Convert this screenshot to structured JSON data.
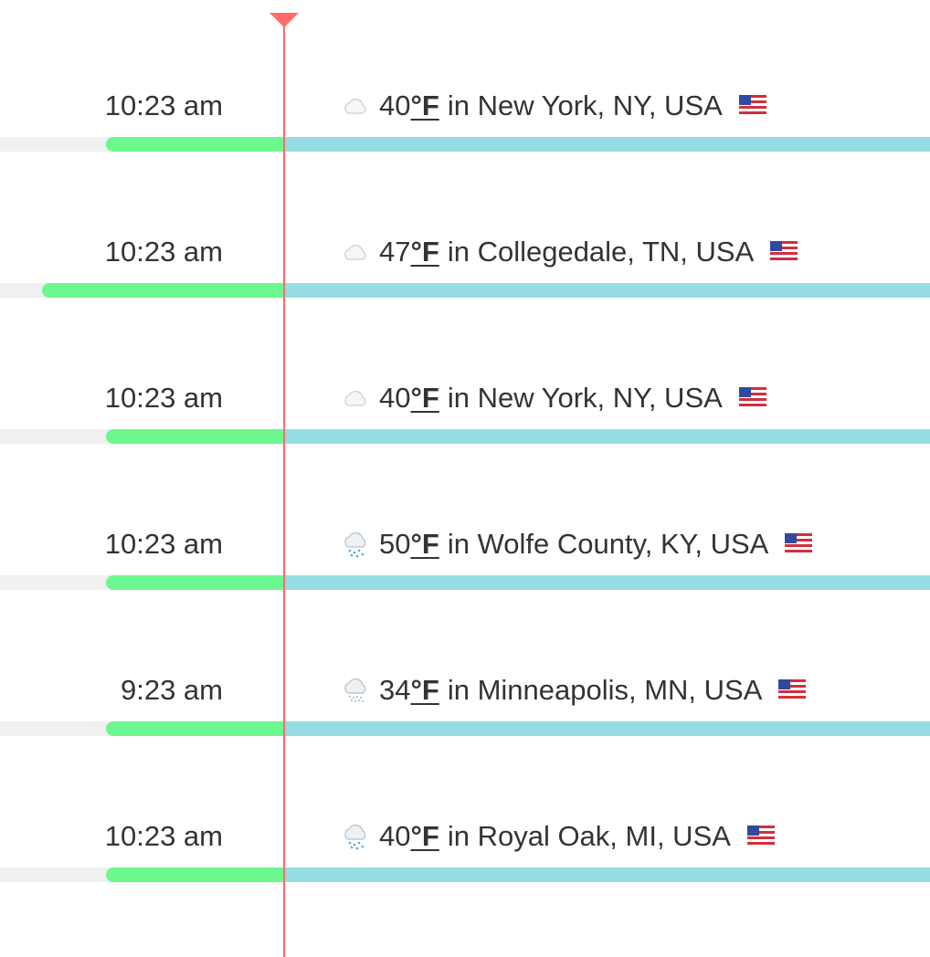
{
  "colors": {
    "now_line": "#ff6b6b",
    "past_bar": "#6cf78f",
    "future_bar": "#98dce3",
    "track": "#f0f0f0",
    "text": "#333333"
  },
  "rows": [
    {
      "time": "10:23 am",
      "icon": "cloud-icon",
      "temp": "40",
      "unit": "°F",
      "location": "in New York, NY, USA",
      "flag": "us-flag-icon"
    },
    {
      "time": "10:23 am",
      "icon": "cloud-icon",
      "temp": "47",
      "unit": "°F",
      "location": "in Collegedale, TN, USA",
      "flag": "us-flag-icon"
    },
    {
      "time": "10:23 am",
      "icon": "cloud-icon",
      "temp": "40",
      "unit": "°F",
      "location": "in New York, NY, USA",
      "flag": "us-flag-icon"
    },
    {
      "time": "10:23 am",
      "icon": "rain-cloud-icon",
      "temp": "50",
      "unit": "°F",
      "location": "in Wolfe County, KY, USA",
      "flag": "us-flag-icon"
    },
    {
      "time": "9:23 am",
      "icon": "snow-cloud-icon",
      "temp": "34",
      "unit": "°F",
      "location": "in Minneapolis, MN, USA",
      "flag": "us-flag-icon"
    },
    {
      "time": "10:23 am",
      "icon": "rain-cloud-icon",
      "temp": "40",
      "unit": "°F",
      "location": "in Royal Oak, MI, USA",
      "flag": "us-flag-icon"
    }
  ]
}
